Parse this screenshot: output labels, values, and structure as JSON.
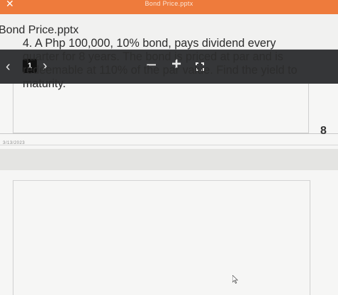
{
  "window": {
    "close_glyph": "✕",
    "title": "Bond Price.pptx"
  },
  "file": {
    "name": "Bond Price.pptx"
  },
  "toolbar": {
    "prev_glyph": "‹",
    "page_number": "1",
    "next_glyph": "›",
    "zoom_out_glyph": "−",
    "zoom_in_glyph": "+",
    "icons": {
      "prev": "chevron-left-icon",
      "next": "chevron-right-icon",
      "zoom_out": "minus-icon",
      "zoom_in": "plus-icon",
      "fit": "fit-to-screen-icon"
    }
  },
  "slides": {
    "previous": {
      "slide_number": "8",
      "date": "3/13/2023"
    },
    "current": {
      "text": "4. A Php 100,000, 10% bond, pays dividend every quarter for 8 years. The bond is priced at par and is redeemable at 110% of the par value. Find the yield to maturity."
    }
  },
  "colors": {
    "top_bar": "#ee7b3c",
    "toolbar": "#353638",
    "slide_bg": "#f6f6f5"
  }
}
